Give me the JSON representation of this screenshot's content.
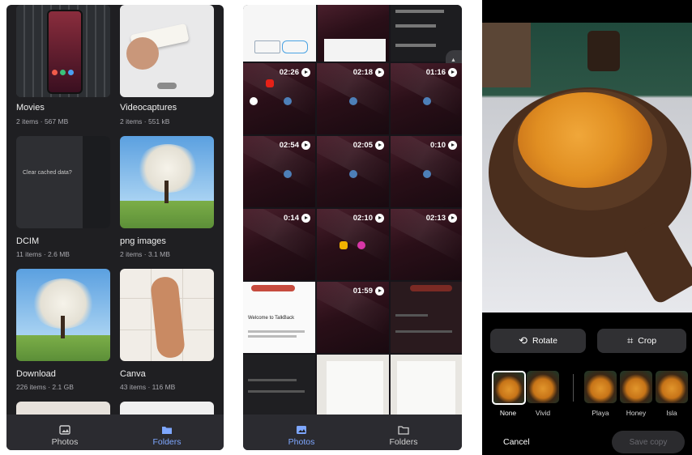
{
  "folders_screen": {
    "folders": [
      {
        "name": "Movies",
        "meta": "2 items · 567 MB"
      },
      {
        "name": "Videocaptures",
        "meta": "2 items · 551 kB"
      },
      {
        "name": "DCIM",
        "meta": "11 items · 2.6 MB"
      },
      {
        "name": "png images",
        "meta": "2 items · 3.1 MB"
      },
      {
        "name": "Download",
        "meta": "226 items · 2.1 GB"
      },
      {
        "name": "Canva",
        "meta": "43 items · 116 MB"
      }
    ],
    "dcim_tile_text": "Clear cached data?",
    "nav": {
      "photos": "Photos",
      "folders": "Folders"
    },
    "colors": {
      "active": "#7ea7ff",
      "inactive": "#d0d0d0"
    }
  },
  "photos_screen": {
    "durations": [
      "02:26",
      "02:18",
      "01:16",
      "02:54",
      "02:05",
      "0:10",
      "0:14",
      "02:10",
      "02:13",
      "01:59"
    ],
    "talkback": {
      "title": "Welcome to TalkBack"
    },
    "nav": {
      "photos": "Photos",
      "folders": "Folders"
    }
  },
  "editor_screen": {
    "rotate_label": "Rotate",
    "crop_label": "Crop",
    "filters": [
      {
        "name": "None"
      },
      {
        "name": "Vivid"
      },
      {
        "name": "Playa"
      },
      {
        "name": "Honey"
      },
      {
        "name": "Isla"
      }
    ],
    "cancel_label": "Cancel",
    "save_label": "Save copy"
  }
}
